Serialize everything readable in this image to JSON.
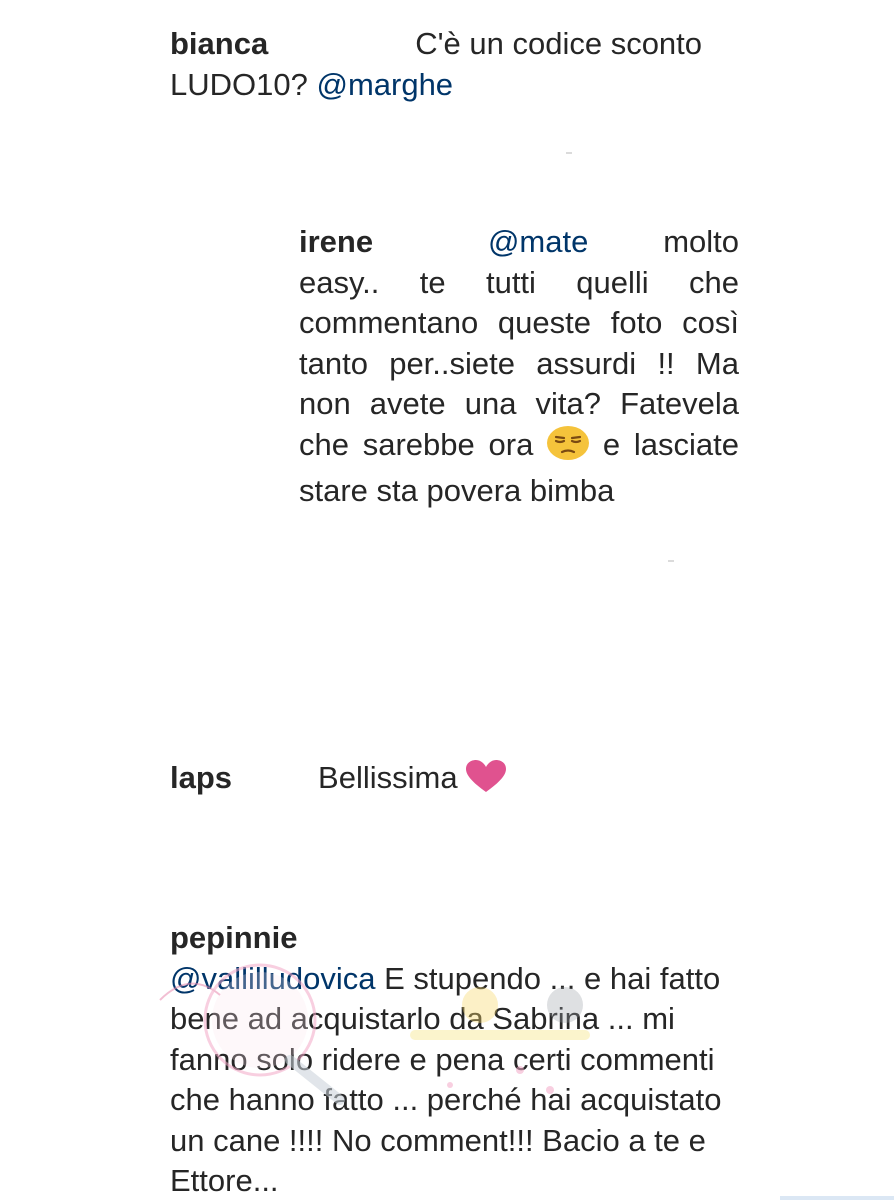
{
  "comments": [
    {
      "username": "bianca",
      "text_before": "C'è un codice sconto LUDO10? ",
      "mention": "@marghe"
    },
    {
      "username": "irene",
      "mention": "@mate",
      "text_before": "molto easy.. te tutti quelli che commentano queste foto così tanto per..siete assurdi !! Ma non avete una vita? Fatevela che sarebbe ora ",
      "emoji": "unamused-face",
      "text_after": " e lasciate stare sta povera bimba"
    },
    {
      "username": "laps",
      "text": "Bellissima ",
      "emoji": "pink-heart"
    },
    {
      "username": "pepinnie",
      "mention": "@vallilludovica",
      "text": " E stupendo ... e hai fatto bene ad acquistarlo da Sabrina ... mi fanno solo ridere e pena certi commenti che hanno fatto ... perché hai acquistato un cane !!!! No comment!!! Bacio a te e Ettore..."
    }
  ],
  "colors": {
    "text": "#262626",
    "mention": "#003569",
    "heart": "#e0528f",
    "emoji_face": "#f5c33b"
  }
}
